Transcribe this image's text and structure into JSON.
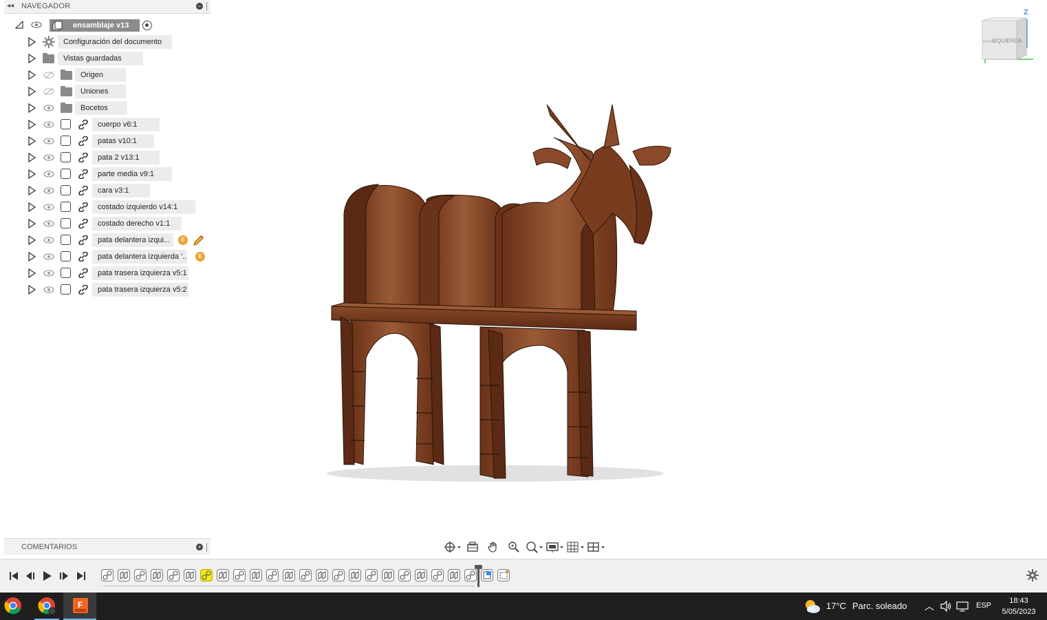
{
  "navigator": {
    "title": "NAVEGADOR",
    "root": {
      "label": "ensamblaje v13"
    },
    "items": [
      {
        "label": "Configuración del documento",
        "type": "settings"
      },
      {
        "label": "Vistas guardadas",
        "type": "folder"
      },
      {
        "label": "Origen",
        "type": "folder",
        "hidden": true
      },
      {
        "label": "Uniones",
        "type": "folder",
        "hidden": true
      },
      {
        "label": "Bocetos",
        "type": "folder"
      },
      {
        "label": "cuerpo v6:1",
        "type": "component"
      },
      {
        "label": "patas v10:1",
        "type": "component"
      },
      {
        "label": "pata 2 v13:1",
        "type": "component"
      },
      {
        "label": "parte media v9:1",
        "type": "component"
      },
      {
        "label": "cara v3:1",
        "type": "component"
      },
      {
        "label": "costado izquierdo v14:1",
        "type": "component"
      },
      {
        "label": "costado derecho v1:1",
        "type": "component"
      },
      {
        "label": "pata delantera izqui...",
        "type": "component",
        "badge": true,
        "edit": true
      },
      {
        "label": "pata delantera izquierda '...",
        "type": "component",
        "badge": true
      },
      {
        "label": "pata trasera izquierza v5:1",
        "type": "component"
      },
      {
        "label": "pata trasera izquierza v5:2",
        "type": "component"
      }
    ]
  },
  "comments": {
    "title": "COMENTARIOS"
  },
  "viewcube": {
    "face_label": "IZQUIERDA",
    "side_label": "FRENTE",
    "axis_z": "Z"
  },
  "toolbar": {
    "buttons": [
      "orbit-icon",
      "look-at-icon",
      "pan-icon",
      "zoom-icon",
      "fit-icon",
      "display-settings-icon",
      "grid-icon",
      "viewports-icon"
    ]
  },
  "timeline": {
    "feature_count": 23,
    "highlighted_index": 6
  },
  "taskbar": {
    "weather_temp": "17°C",
    "weather_text": "Parc. soleado",
    "language": "ESP",
    "time": "18:43",
    "date": "5/05/2023"
  },
  "colors": {
    "wood_dark": "#5a2a14",
    "wood_mid": "#8a4a2a",
    "wood_light": "#a86a44",
    "highlight": "#f2e81a"
  }
}
